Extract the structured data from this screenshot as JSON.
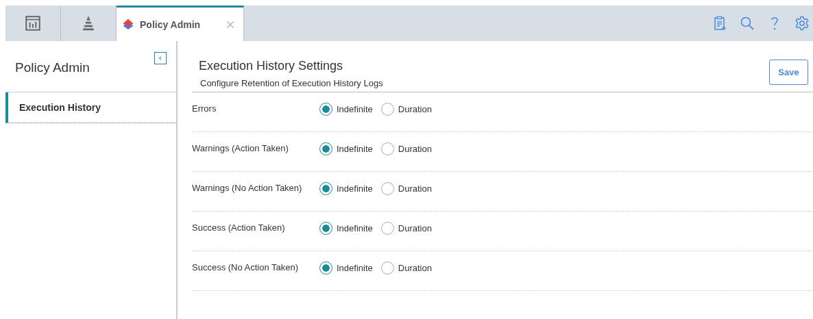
{
  "tabs": [
    {
      "kind": "icon",
      "selected": false
    },
    {
      "kind": "icon",
      "selected": false
    },
    {
      "kind": "text",
      "label": "Policy Admin",
      "selected": true
    }
  ],
  "sidebar": {
    "title": "Policy Admin",
    "items": [
      {
        "label": "Execution History",
        "selected": true
      }
    ]
  },
  "header": {
    "title": "Execution History Settings",
    "subtitle": "Configure Retention of Execution History Logs",
    "save": "Save"
  },
  "settings": [
    {
      "label": "Errors",
      "options": [
        {
          "label": "Indefinite",
          "selected": true
        },
        {
          "label": "Duration",
          "selected": false
        }
      ]
    },
    {
      "label": "Warnings (Action Taken)",
      "options": [
        {
          "label": "Indefinite",
          "selected": true
        },
        {
          "label": "Duration",
          "selected": false
        }
      ]
    },
    {
      "label": "Warnings (No Action Taken)",
      "options": [
        {
          "label": "Indefinite",
          "selected": true
        },
        {
          "label": "Duration",
          "selected": false
        }
      ]
    },
    {
      "label": "Success (Action Taken)",
      "options": [
        {
          "label": "Indefinite",
          "selected": true
        },
        {
          "label": "Duration",
          "selected": false
        }
      ]
    },
    {
      "label": "Success (No Action Taken)",
      "options": [
        {
          "label": "Indefinite",
          "selected": true
        },
        {
          "label": "Duration",
          "selected": false
        }
      ]
    }
  ]
}
